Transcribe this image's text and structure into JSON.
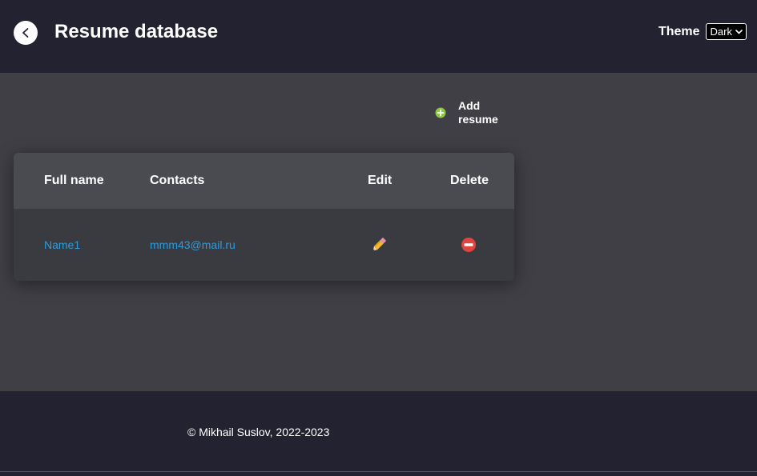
{
  "header": {
    "title": "Resume database",
    "back_icon": "chevron-left-icon",
    "theme_label": "Theme",
    "theme_selected": "Dark"
  },
  "actions": {
    "add_label": "Add resume",
    "add_icon": "plus-circle-icon"
  },
  "table": {
    "columns": [
      "Full name",
      "Contacts",
      "Edit",
      "Delete"
    ],
    "rows": [
      {
        "full_name": "Name1",
        "contacts": "mmm43@mail.ru",
        "edit_icon": "pencil-icon",
        "delete_icon": "no-entry-icon"
      }
    ]
  },
  "footer": {
    "copyright": "© Mikhail Suslov, 2022-2023"
  },
  "colors": {
    "header_bg": "#232230",
    "main_bg": "#403f46",
    "table_head_bg": "#4a4a51",
    "table_row_bg": "#3a3a41",
    "link": "#2d9cdb",
    "add_icon": "#8dc63f",
    "delete_icon": "#e0443e"
  }
}
